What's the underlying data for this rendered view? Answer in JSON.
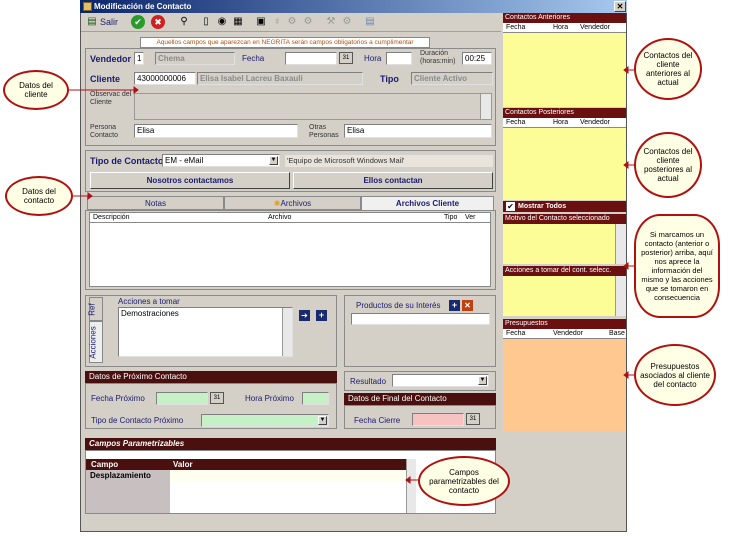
{
  "window": {
    "title": "Modificación de Contacto",
    "close_glyph": "✕"
  },
  "toolbar": {
    "exit_label": "Salir"
  },
  "notice": "Aquellos campos que aparezcan en NEGRITA serán campos obligatorios a cumplimentar",
  "form": {
    "vendedor_label": "Vendedor",
    "vendedor_code": "1",
    "vendedor_name": "Chema",
    "fecha_label": "Fecha",
    "fecha_value": "",
    "hora_label": "Hora",
    "hora_value": "",
    "duracion_label": "Duración (horas:min)",
    "duracion_value": "00:25",
    "cliente_label": "Cliente",
    "cliente_code": "43000000006",
    "cliente_name": "Elisa Isabel Lacreu Baxauli",
    "tipo_label": "Tipo",
    "tipo_value": "Cliente Activo",
    "observac_label": "Observac del Cliente",
    "persona_label": "Persona Contacto",
    "persona_value": "Elisa",
    "otras_label": "Otras Personas",
    "otras_value": "Elisa"
  },
  "tipo_contacto": {
    "label": "Tipo de Contacto",
    "value": "EM - eMail",
    "description": "'Equipo de Microsoft Windows Mail'",
    "btn_nosotros": "Nosotros contactamos",
    "btn_ellos": "Ellos contactan"
  },
  "tabs": [
    {
      "label": "Notas"
    },
    {
      "label": "Archivos"
    },
    {
      "label": "Archivos Cliente"
    }
  ],
  "files_table": {
    "columns": [
      "Descripción",
      "Archivo",
      "Tipo",
      "Ver"
    ]
  },
  "acciones": {
    "side_tab_ref": "Ref",
    "side_tab_acciones": "Acciones",
    "title": "Acciones a tomar",
    "value": "Demostraciones"
  },
  "productos": {
    "title": "Productos de su Interés"
  },
  "proximo": {
    "header": "Datos de Próximo Contacto",
    "fecha_label": "Fecha Próximo",
    "hora_label": "Hora Próximo",
    "tipo_label": "Tipo de Contacto Próximo"
  },
  "resultado": {
    "label": "Resultado"
  },
  "final": {
    "header": "Datos de Final del Contacto",
    "fecha_cierre_label": "Fecha Cierre"
  },
  "campos": {
    "header": "Campos Parametrizables",
    "col_campo": "Campo",
    "col_valor": "Valor",
    "rows": [
      {
        "campo": "Desplazamiento",
        "valor": ""
      }
    ]
  },
  "right": {
    "anteriores": {
      "header": "Contactos Anteriores",
      "cols": [
        "Fecha",
        "Hora",
        "Vendedor"
      ]
    },
    "posteriores": {
      "header": "Contactos Posteriores",
      "cols": [
        "Fecha",
        "Hora",
        "Vendedor"
      ]
    },
    "mostrar_todos": "Mostrar Todos",
    "motivo": "Motivo del Contacto seleccionado",
    "acciones_tomar": "Acciones a tomar del cont. selecc.",
    "presupuestos": {
      "header": "Presupuestos",
      "cols": [
        "Fecha",
        "Vendedor",
        "Base"
      ]
    }
  },
  "callouts": {
    "datos_cliente": "Datos del cliente",
    "datos_contacto": "Datos del contacto",
    "anteriores": "Contactos del cliente anteriores al actual",
    "posteriores": "Contactos del cliente posteriores al actual",
    "seleccion": "Si marcamos un contacto (anterior o posterior) arriba, aquí nos aprece la información del mismo y las acciones que se tomaron en consecuencia",
    "presupuestos": "Presupuestos asociados al cliente del contacto",
    "campos": "Campos parametrizables del contacto"
  },
  "colors": {
    "title_bar": "#0a246a",
    "dark_header": "#4a0f0f",
    "yellow_panel": "#fdfd98",
    "orange_panel": "#ffc890",
    "callout_border": "#b01010"
  }
}
